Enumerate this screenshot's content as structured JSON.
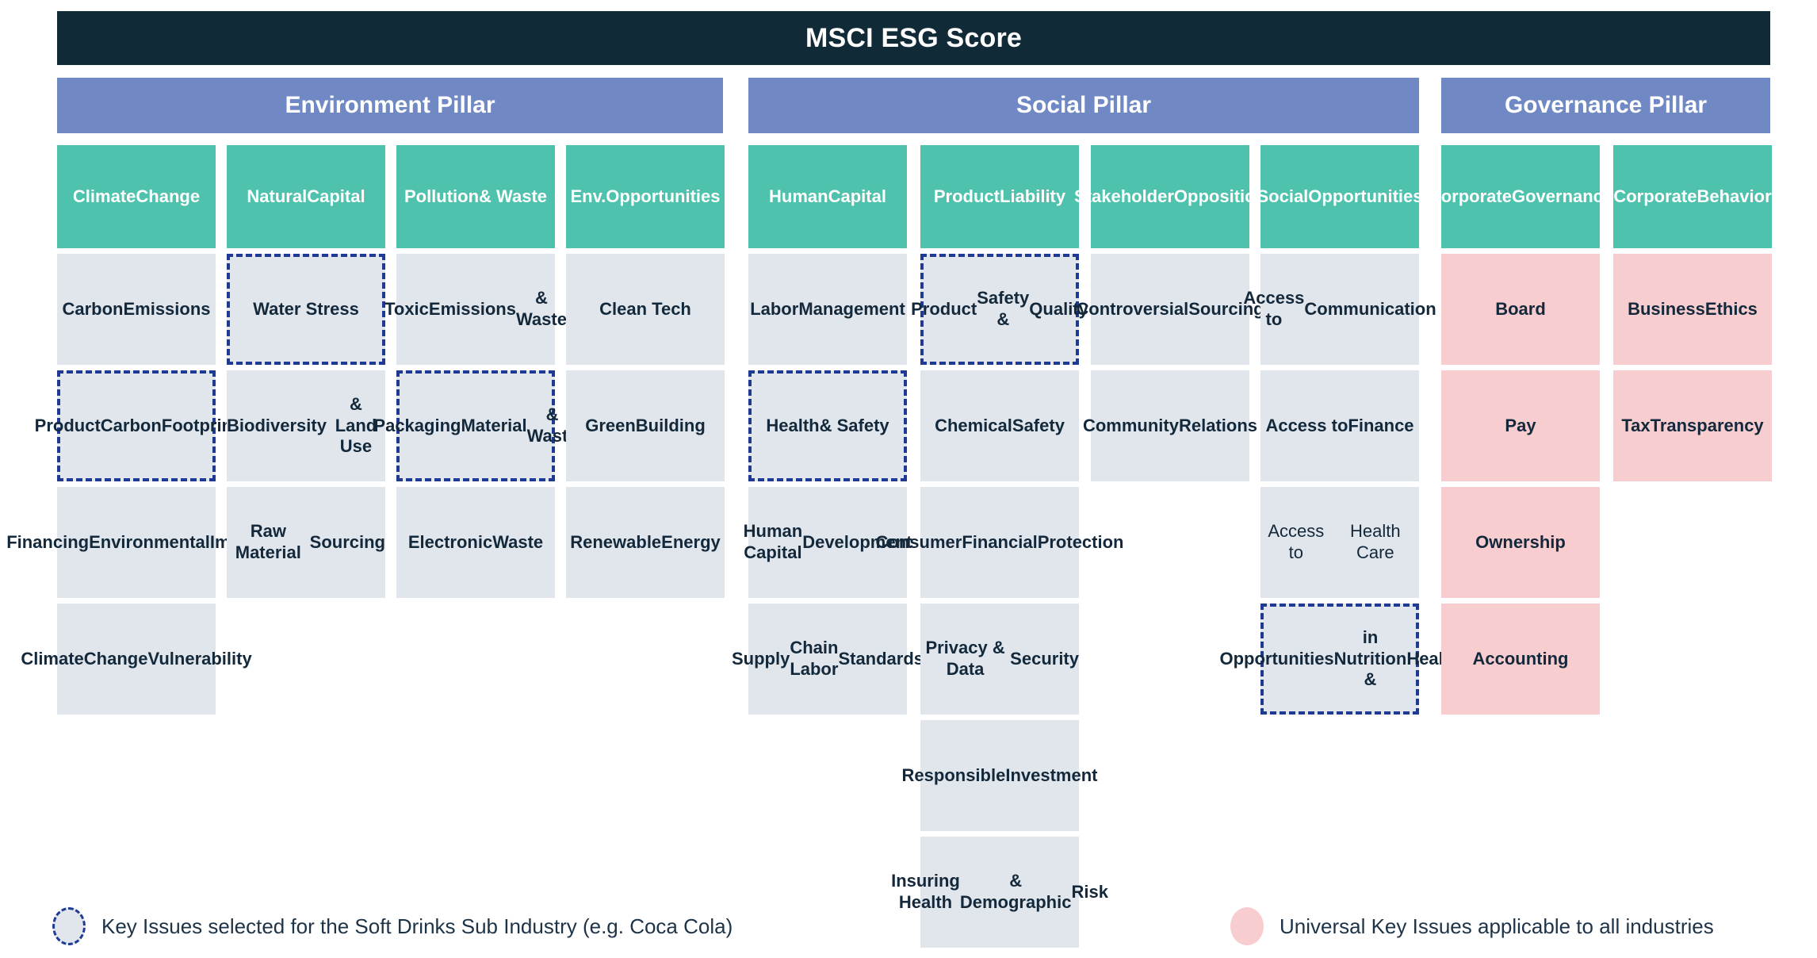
{
  "header": {
    "title": "MSCI ESG Score"
  },
  "colors": {
    "title_bar": "#112a38",
    "pillar_bar": "#7089c4",
    "category_header": "#4ec2ad",
    "issue_box": "#e1e6ec",
    "universal_issue": "#f8cdd0",
    "selected_border": "#1f3a93",
    "text_dark": "#13293b",
    "text_light": "#ffffff"
  },
  "pillars": [
    {
      "label": "Environment Pillar",
      "column_span": 4
    },
    {
      "label": "Social Pillar",
      "column_span": 4
    },
    {
      "label": "Governance Pillar",
      "column_span": 2
    }
  ],
  "columns": [
    {
      "category": "Climate\nChange",
      "category_line1": "Climate",
      "category_line2": "Change",
      "issues": [
        {
          "label": "Carbon\nEmissions",
          "selected": false,
          "universal": false
        },
        {
          "label": "Product\nCarbon\nFootprint",
          "selected": true,
          "universal": false
        },
        {
          "label": "Financing\nEnvironmental\nImpact",
          "selected": false,
          "universal": false
        },
        {
          "label": "Climate\nChange\nVulnerability",
          "selected": false,
          "universal": false
        }
      ]
    },
    {
      "category": "Natural\nCapital",
      "issues": [
        {
          "label": "Water Stress",
          "selected": true,
          "universal": false
        },
        {
          "label": "Biodiversity\n& Land Use",
          "selected": false,
          "universal": false
        },
        {
          "label": "Raw Material\nSourcing",
          "selected": false,
          "universal": false
        }
      ]
    },
    {
      "category": "Pollution\n& Waste",
      "issues": [
        {
          "label": "Toxic\nEmissions\n& Waste",
          "selected": false,
          "universal": false
        },
        {
          "label": "Packaging\nMaterial\n& Waste",
          "selected": true,
          "universal": false
        },
        {
          "label": "Electronic\nWaste",
          "selected": false,
          "universal": false
        }
      ]
    },
    {
      "category": "Env.\nOpportunities",
      "issues": [
        {
          "label": "Clean Tech",
          "selected": false,
          "universal": false
        },
        {
          "label": "Green\nBuilding",
          "selected": false,
          "universal": false
        },
        {
          "label": "Renewable\nEnergy",
          "selected": false,
          "universal": false
        }
      ]
    },
    {
      "category": "Human\nCapital",
      "issues": [
        {
          "label": "Labor\nManagement",
          "selected": false,
          "universal": false
        },
        {
          "label": "Health\n& Safety",
          "selected": true,
          "universal": false
        },
        {
          "label": "Human Capital\nDevelopment",
          "selected": false,
          "universal": false
        },
        {
          "label": "Supply\nChain Labor\nStandards",
          "selected": false,
          "universal": false
        }
      ]
    },
    {
      "category": "Product\nLiability",
      "issues": [
        {
          "label": "Product\nSafety &\nQuality",
          "selected": true,
          "universal": false
        },
        {
          "label": "Chemical\nSafety",
          "selected": false,
          "universal": false
        },
        {
          "label": "Consumer\nFinancial\nProtection",
          "selected": false,
          "universal": false
        },
        {
          "label": "Privacy  & Data\nSecurity",
          "selected": false,
          "universal": false
        },
        {
          "label": "Responsible\nInvestment",
          "selected": false,
          "universal": false
        },
        {
          "label": "Insuring Health\n& Demographic\nRisk",
          "selected": false,
          "universal": false
        }
      ]
    },
    {
      "category": "Stakeholder\nOpposition",
      "issues": [
        {
          "label": "Controversial\nSourcing",
          "selected": false,
          "universal": false
        },
        {
          "label": "Community\nRelations",
          "selected": false,
          "universal": false
        }
      ]
    },
    {
      "category": "Social\nOpportunities",
      "issues": [
        {
          "label": "Access to\nCommunication",
          "selected": false,
          "universal": false
        },
        {
          "label": "Access to\nFinance",
          "selected": false,
          "universal": false
        },
        {
          "label": "Access to\nHealth Care",
          "selected": false,
          "universal": false,
          "light": true
        },
        {
          "label": "Opportunities\nin Nutrition &\nHealth",
          "selected": true,
          "universal": false
        }
      ]
    },
    {
      "category": "Corporate\nGovernance",
      "issues": [
        {
          "label": "Board",
          "selected": false,
          "universal": true
        },
        {
          "label": "Pay",
          "selected": false,
          "universal": true
        },
        {
          "label": "Ownership",
          "selected": false,
          "universal": true
        },
        {
          "label": "Accounting",
          "selected": false,
          "universal": true
        }
      ]
    },
    {
      "category": "Corporate\nBehavior",
      "issues": [
        {
          "label": "Business\nEthics",
          "selected": false,
          "universal": true
        },
        {
          "label": "Tax\nTransparency",
          "selected": false,
          "universal": true
        }
      ]
    }
  ],
  "legend": {
    "selected": {
      "swatch": "dashed-blue-circle",
      "label": "Key Issues selected for the Soft Drinks Sub Industry (e.g. Coca Cola)"
    },
    "universal": {
      "swatch": "pink-circle",
      "label": "Universal Key Issues applicable to all industries"
    }
  }
}
